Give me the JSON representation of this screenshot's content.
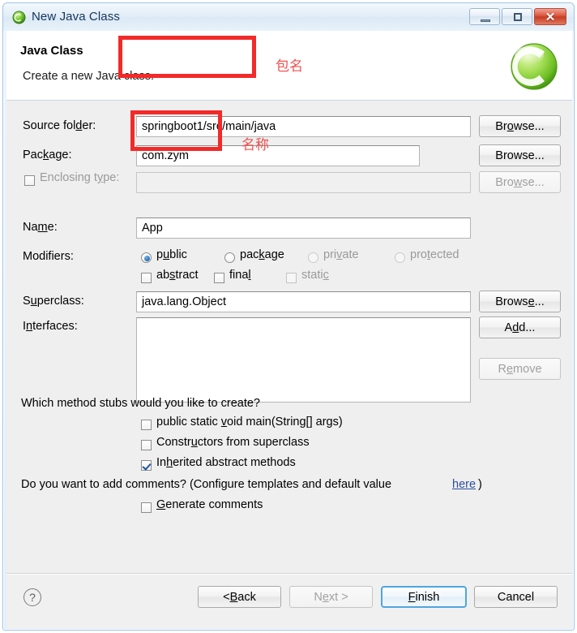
{
  "window": {
    "title": "New Java Class",
    "icon": "java-class-icon",
    "controls": {
      "minimize": "minimize-icon",
      "maximize": "maximize-icon",
      "close": "close-icon"
    }
  },
  "header": {
    "title": "Java Class",
    "description": "Create a new Java class.",
    "logo": "eclipse-c-logo"
  },
  "form": {
    "source_folder": {
      "label": "Source fol",
      "label_accel": "d",
      "label_tail": "er:",
      "value": "springboot1/src/main/java",
      "browse": "Br",
      "browse_accel": "o",
      "browse_tail": "wse..."
    },
    "package": {
      "label": "Pac",
      "label_accel": "k",
      "label_tail": "age:",
      "value": "com.zym",
      "browse": "Browse..."
    },
    "enclosing_type": {
      "label": "Enclosing t",
      "label_accel": "y",
      "label_tail": "pe:",
      "value": "",
      "checked": false,
      "browse": "Bro",
      "browse_accel": "w",
      "browse_tail": "se..."
    },
    "name": {
      "label": "Na",
      "label_accel": "m",
      "label_tail": "e:",
      "value": "App"
    },
    "modifiers": {
      "label": "Modifiers:",
      "radios": [
        {
          "label": "p",
          "accel": "u",
          "tail": "blic",
          "selected": true,
          "enabled": true
        },
        {
          "label": "pac",
          "accel": "k",
          "tail": "age",
          "selected": false,
          "enabled": true
        },
        {
          "label": "pri",
          "accel": "v",
          "tail": "ate",
          "selected": false,
          "enabled": false
        },
        {
          "label": "pro",
          "accel": "t",
          "tail": "ected",
          "selected": false,
          "enabled": false
        }
      ],
      "checkboxes": [
        {
          "label": "ab",
          "accel": "s",
          "tail": "tract",
          "checked": false,
          "enabled": true
        },
        {
          "label": "fina",
          "accel": "l",
          "tail": "",
          "checked": false,
          "enabled": true
        },
        {
          "label": "stati",
          "accel": "c",
          "tail": "",
          "checked": false,
          "enabled": false
        }
      ]
    },
    "superclass": {
      "label": "S",
      "label_accel": "u",
      "label_tail": "perclass:",
      "value": "java.lang.Object",
      "browse": "Brows",
      "browse_accel": "e",
      "browse_tail": "..."
    },
    "interfaces": {
      "label": "I",
      "label_accel": "n",
      "label_tail": "terfaces:",
      "value": "",
      "add": "A",
      "add_accel": "d",
      "add_tail": "d...",
      "remove": "R",
      "remove_accel": "e",
      "remove_tail": "move"
    }
  },
  "stubs": {
    "question": "Which method stubs would you like to create?",
    "items": [
      {
        "label": "public static ",
        "accel": "v",
        "tail": "oid main(String[] args)",
        "checked": false
      },
      {
        "label": "Constr",
        "accel": "u",
        "tail": "ctors from superclass",
        "checked": false
      },
      {
        "label": "In",
        "accel": "h",
        "tail": "erited abstract methods",
        "checked": true
      }
    ]
  },
  "comments": {
    "question_prefix": "Do you want to add comments? (Configure templates and default value ",
    "link": "here",
    "question_suffix": ")",
    "generate": {
      "label": "",
      "accel": "G",
      "tail": "enerate comments",
      "checked": false
    }
  },
  "footer": {
    "help": "?",
    "back": {
      "label": "< ",
      "accel": "B",
      "tail": "ack",
      "enabled": true,
      "default": false
    },
    "next": {
      "label": "N",
      "accel": "e",
      "tail": "xt >",
      "enabled": false,
      "default": false
    },
    "finish": {
      "label": "",
      "accel": "F",
      "tail": "inish",
      "enabled": true,
      "default": true
    },
    "cancel": {
      "label": "Cancel",
      "accel": "",
      "tail": "",
      "enabled": true,
      "default": false
    }
  },
  "annotations": [
    {
      "id": "package-annotation",
      "text": "包名",
      "note": "red highlight box around Package field"
    },
    {
      "id": "name-annotation",
      "text": "名称",
      "note": "red highlight box around Name field"
    }
  ],
  "colors": {
    "annotation_red": "#f22a29",
    "annotation_text_red": "#f0524f",
    "link_blue": "#2b4f9e",
    "default_button_border": "#4ea6dd"
  }
}
